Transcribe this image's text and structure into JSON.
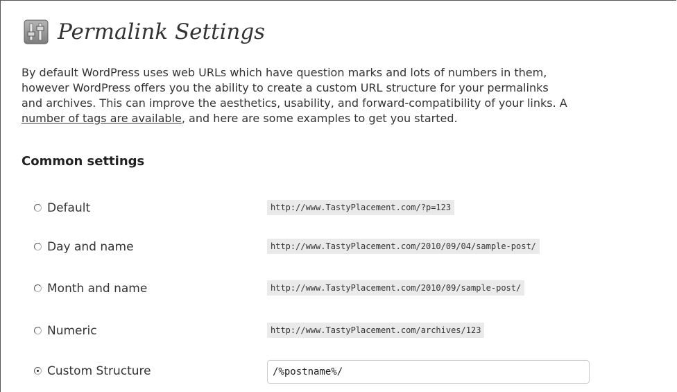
{
  "header": {
    "title": "Permalink Settings",
    "icon": "settings-sliders-icon"
  },
  "intro": {
    "line1": "By default WordPress uses web URLs which have question marks and lots of numbers in them,",
    "line2": "however WordPress offers you the ability to create a custom URL structure for your permalinks",
    "line3": "and archives. This can improve the aesthetics, usability, and forward-compatibility of your links. A",
    "tags_link": "number of tags are available",
    "line4_rest": ", and here are some examples to get you started."
  },
  "common_settings": {
    "heading": "Common settings",
    "options": [
      {
        "label": "Default",
        "example": "http://www.TastyPlacement.com/?p=123",
        "checked": false
      },
      {
        "label": "Day and name",
        "example": "http://www.TastyPlacement.com/2010/09/04/sample-post/",
        "checked": false
      },
      {
        "label": "Month and name",
        "example": "http://www.TastyPlacement.com/2010/09/sample-post/",
        "checked": false
      },
      {
        "label": "Numeric",
        "example": "http://www.TastyPlacement.com/archives/123",
        "checked": false
      },
      {
        "label": "Custom Structure",
        "value": "/%postname%/",
        "checked": true
      }
    ]
  }
}
